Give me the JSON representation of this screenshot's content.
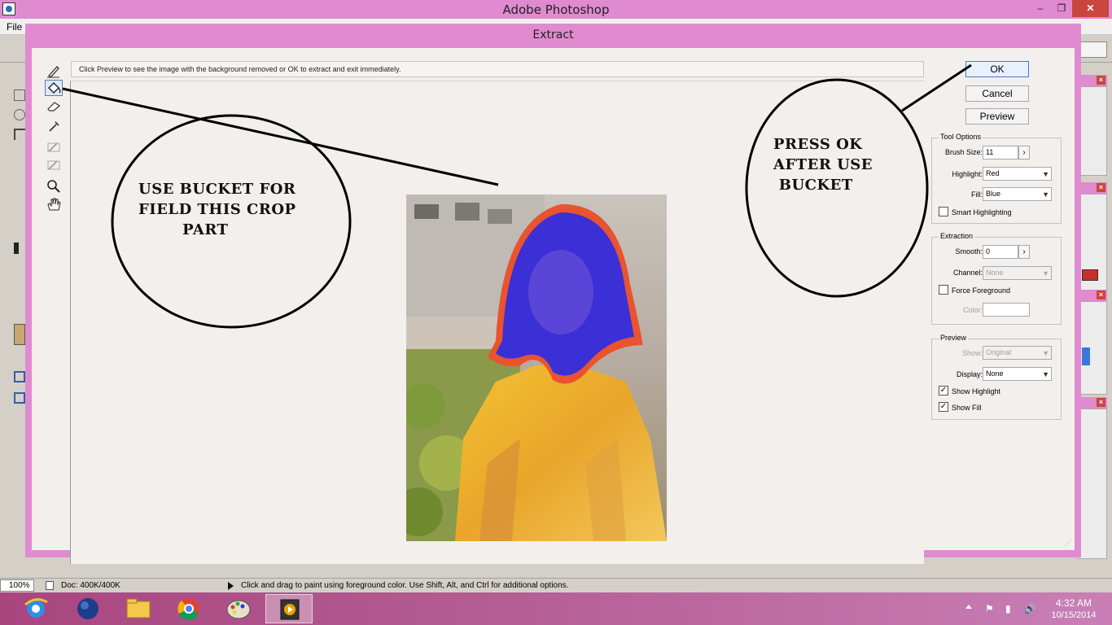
{
  "app": {
    "title": "Adobe Photoshop"
  },
  "menu": {
    "file": "File"
  },
  "window_controls": {
    "minimize": "‒",
    "restore": "❐",
    "close": "✕"
  },
  "dialog": {
    "title": "Extract",
    "hint": "Click Preview to see the image with the background removed or OK to extract and exit immediately.",
    "buttons": {
      "ok": "OK",
      "cancel": "Cancel",
      "preview": "Preview"
    },
    "tool_options": {
      "title": "Tool Options",
      "brush_size_label": "Brush Size:",
      "brush_size_value": "11",
      "highlight_label": "Highlight:",
      "highlight_value": "Red",
      "fill_label": "Fill:",
      "fill_value": "Blue",
      "smart_highlighting_label": "Smart Highlighting",
      "smart_highlighting_checked": false
    },
    "extraction": {
      "title": "Extraction",
      "smooth_label": "Smooth:",
      "smooth_value": "0",
      "channel_label": "Channel:",
      "channel_value": "None",
      "force_foreground_label": "Force Foreground",
      "force_foreground_checked": false,
      "color_label": "Color:"
    },
    "preview": {
      "title": "Preview",
      "show_label": "Show:",
      "show_value": "Original",
      "display_label": "Display:",
      "display_value": "None",
      "show_highlight_label": "Show Highlight",
      "show_highlight_checked": true,
      "show_fill_label": "Show Fill",
      "show_fill_checked": true
    },
    "tools": [
      "edge-highlighter-icon",
      "fill-bucket-icon",
      "eraser-icon",
      "eyedropper-icon",
      "cleanup-icon",
      "edge-touchup-icon",
      "zoom-icon",
      "hand-icon"
    ]
  },
  "annotations": {
    "left_note": "USE BUCKET FOR\nFIELD THIS CROP\n        PART",
    "right_note": "PRESS OK\nAFTER USE\n BUCKET"
  },
  "status": {
    "zoom": "100%",
    "doc": "Doc: 400K/400K",
    "message": "Click and drag to paint using foreground color.  Use Shift, Alt, and Ctrl for additional options."
  },
  "taskbar": {
    "apps": [
      "internet-explorer-icon",
      "globe-icon",
      "file-explorer-icon",
      "chrome-icon",
      "paint-icon",
      "media-player-icon"
    ],
    "time": "4:32 AM",
    "date": "10/15/2014"
  },
  "colors": {
    "title_bar": "#e08ad0",
    "highlight": "#e8502e",
    "fill": "#3b2fd6",
    "close_button": "#c9463d"
  }
}
